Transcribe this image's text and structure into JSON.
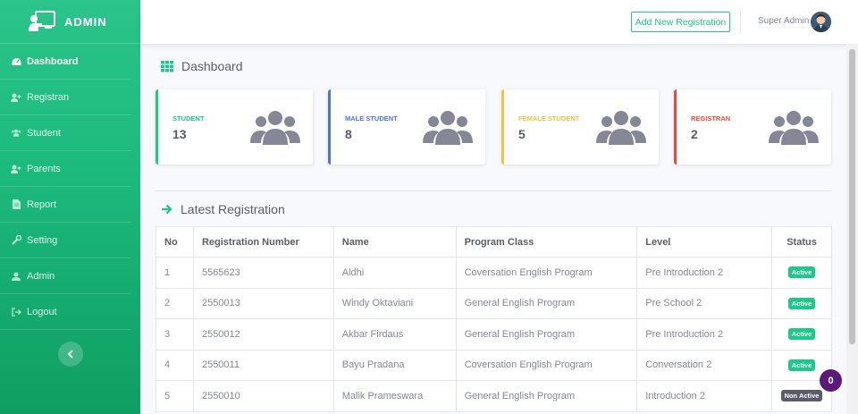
{
  "brand": {
    "name": "ADMIN"
  },
  "sidebar": {
    "items": [
      {
        "label": "Dashboard",
        "icon": "dashboard-icon",
        "active": true
      },
      {
        "label": "Registran",
        "icon": "user-plus-icon"
      },
      {
        "label": "Student",
        "icon": "users-icon"
      },
      {
        "label": "Parents",
        "icon": "user-plus-icon"
      },
      {
        "label": "Report",
        "icon": "file-icon"
      },
      {
        "label": "Setting",
        "icon": "wrench-icon"
      },
      {
        "label": "Admin",
        "icon": "user-icon"
      },
      {
        "label": "Logout",
        "icon": "logout-icon"
      }
    ],
    "toggle_icon": "chevron-left-icon"
  },
  "topbar": {
    "add_button_label": "Add New Registration",
    "user_name": "Super Admin"
  },
  "page": {
    "title": "Dashboard"
  },
  "cards": [
    {
      "label": "STUDENT",
      "value": "13",
      "color": "#1cc88a"
    },
    {
      "label": "MALE STUDENT",
      "value": "8",
      "color": "#4e73df"
    },
    {
      "label": "FEMALE STUDENT",
      "value": "5",
      "color": "#f6c23e"
    },
    {
      "label": "REGISTRAN",
      "value": "2",
      "color": "#e74a3b"
    }
  ],
  "latest": {
    "title": "Latest Registration",
    "columns": [
      "No",
      "Registration Number",
      "Name",
      "Program Class",
      "Level",
      "Status"
    ],
    "rows": [
      [
        "1",
        "5565623",
        "Aldhi",
        "Coversation English Program",
        "Pre Introduction 2",
        "Active"
      ],
      [
        "2",
        "2550013",
        "Windy Oktaviani",
        "General English Program",
        "Pre School 2",
        "Active"
      ],
      [
        "3",
        "2550012",
        "Akbar Firdaus",
        "General English Program",
        "Pre Introduction 2",
        "Active"
      ],
      [
        "4",
        "2550011",
        "Bayu Pradana",
        "Coversation English Program",
        "Conversation 2",
        "Active"
      ],
      [
        "5",
        "2550010",
        "Malik Prameswara",
        "General English Program",
        "Introduction 2",
        "Non Active"
      ]
    ]
  },
  "notification": {
    "count": "0"
  }
}
